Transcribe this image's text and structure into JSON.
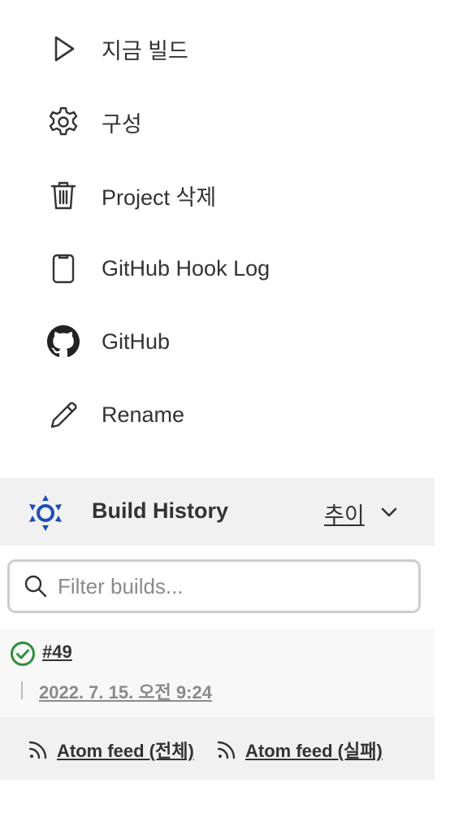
{
  "menu": {
    "items": [
      {
        "label": "지금 빌드",
        "icon": "play-icon"
      },
      {
        "label": "구성",
        "icon": "gear-icon"
      },
      {
        "label": "Project 삭제",
        "icon": "trash-icon"
      },
      {
        "label": "GitHub Hook Log",
        "icon": "clipboard-icon"
      },
      {
        "label": "GitHub",
        "icon": "github-icon"
      },
      {
        "label": "Rename",
        "icon": "pencil-icon"
      }
    ]
  },
  "build_history": {
    "title": "Build History",
    "trend_label": "추이",
    "icon": "build-history-icon",
    "accent_color": "#1d4dba",
    "filter_placeholder": "Filter builds...",
    "builds": [
      {
        "number": "#49",
        "date": "2022. 7. 15. 오전 9:24",
        "status": "success",
        "status_color": "#2f8f3a"
      }
    ],
    "feeds": [
      {
        "label": "Atom feed (전체)",
        "icon": "rss-icon"
      },
      {
        "label": "Atom feed (실패)",
        "icon": "rss-icon"
      }
    ]
  }
}
